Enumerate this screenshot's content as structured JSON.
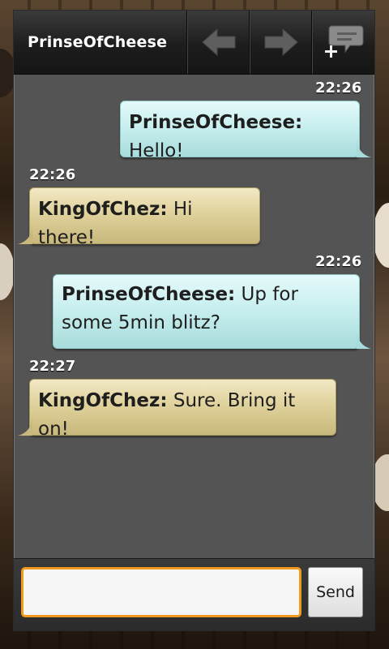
{
  "header": {
    "title": "PrinseOfCheese"
  },
  "toolbar": {
    "back_icon": "arrow-left-icon",
    "forward_icon": "arrow-right-icon",
    "new_chat_icon": "new-chat-icon"
  },
  "messages": [
    {
      "time": "22:26",
      "sender": "PrinseOfCheese:",
      "text": " Hello!",
      "side": "mine"
    },
    {
      "time": "22:26",
      "sender": "KingOfChez:",
      "text": " Hi there!",
      "side": "theirs"
    },
    {
      "time": "22:26",
      "sender": "PrinseOfCheese:",
      "text": " Up for some 5min blitz?",
      "side": "mine"
    },
    {
      "time": "22:27",
      "sender": "KingOfChez:",
      "text": " Sure. Bring it on!",
      "side": "theirs"
    }
  ],
  "compose": {
    "value": "",
    "send_label": "Send"
  },
  "colors": {
    "accent": "#f29a1d",
    "mine_bubble": "#c9efef",
    "theirs_bubble": "#e0d29c"
  }
}
